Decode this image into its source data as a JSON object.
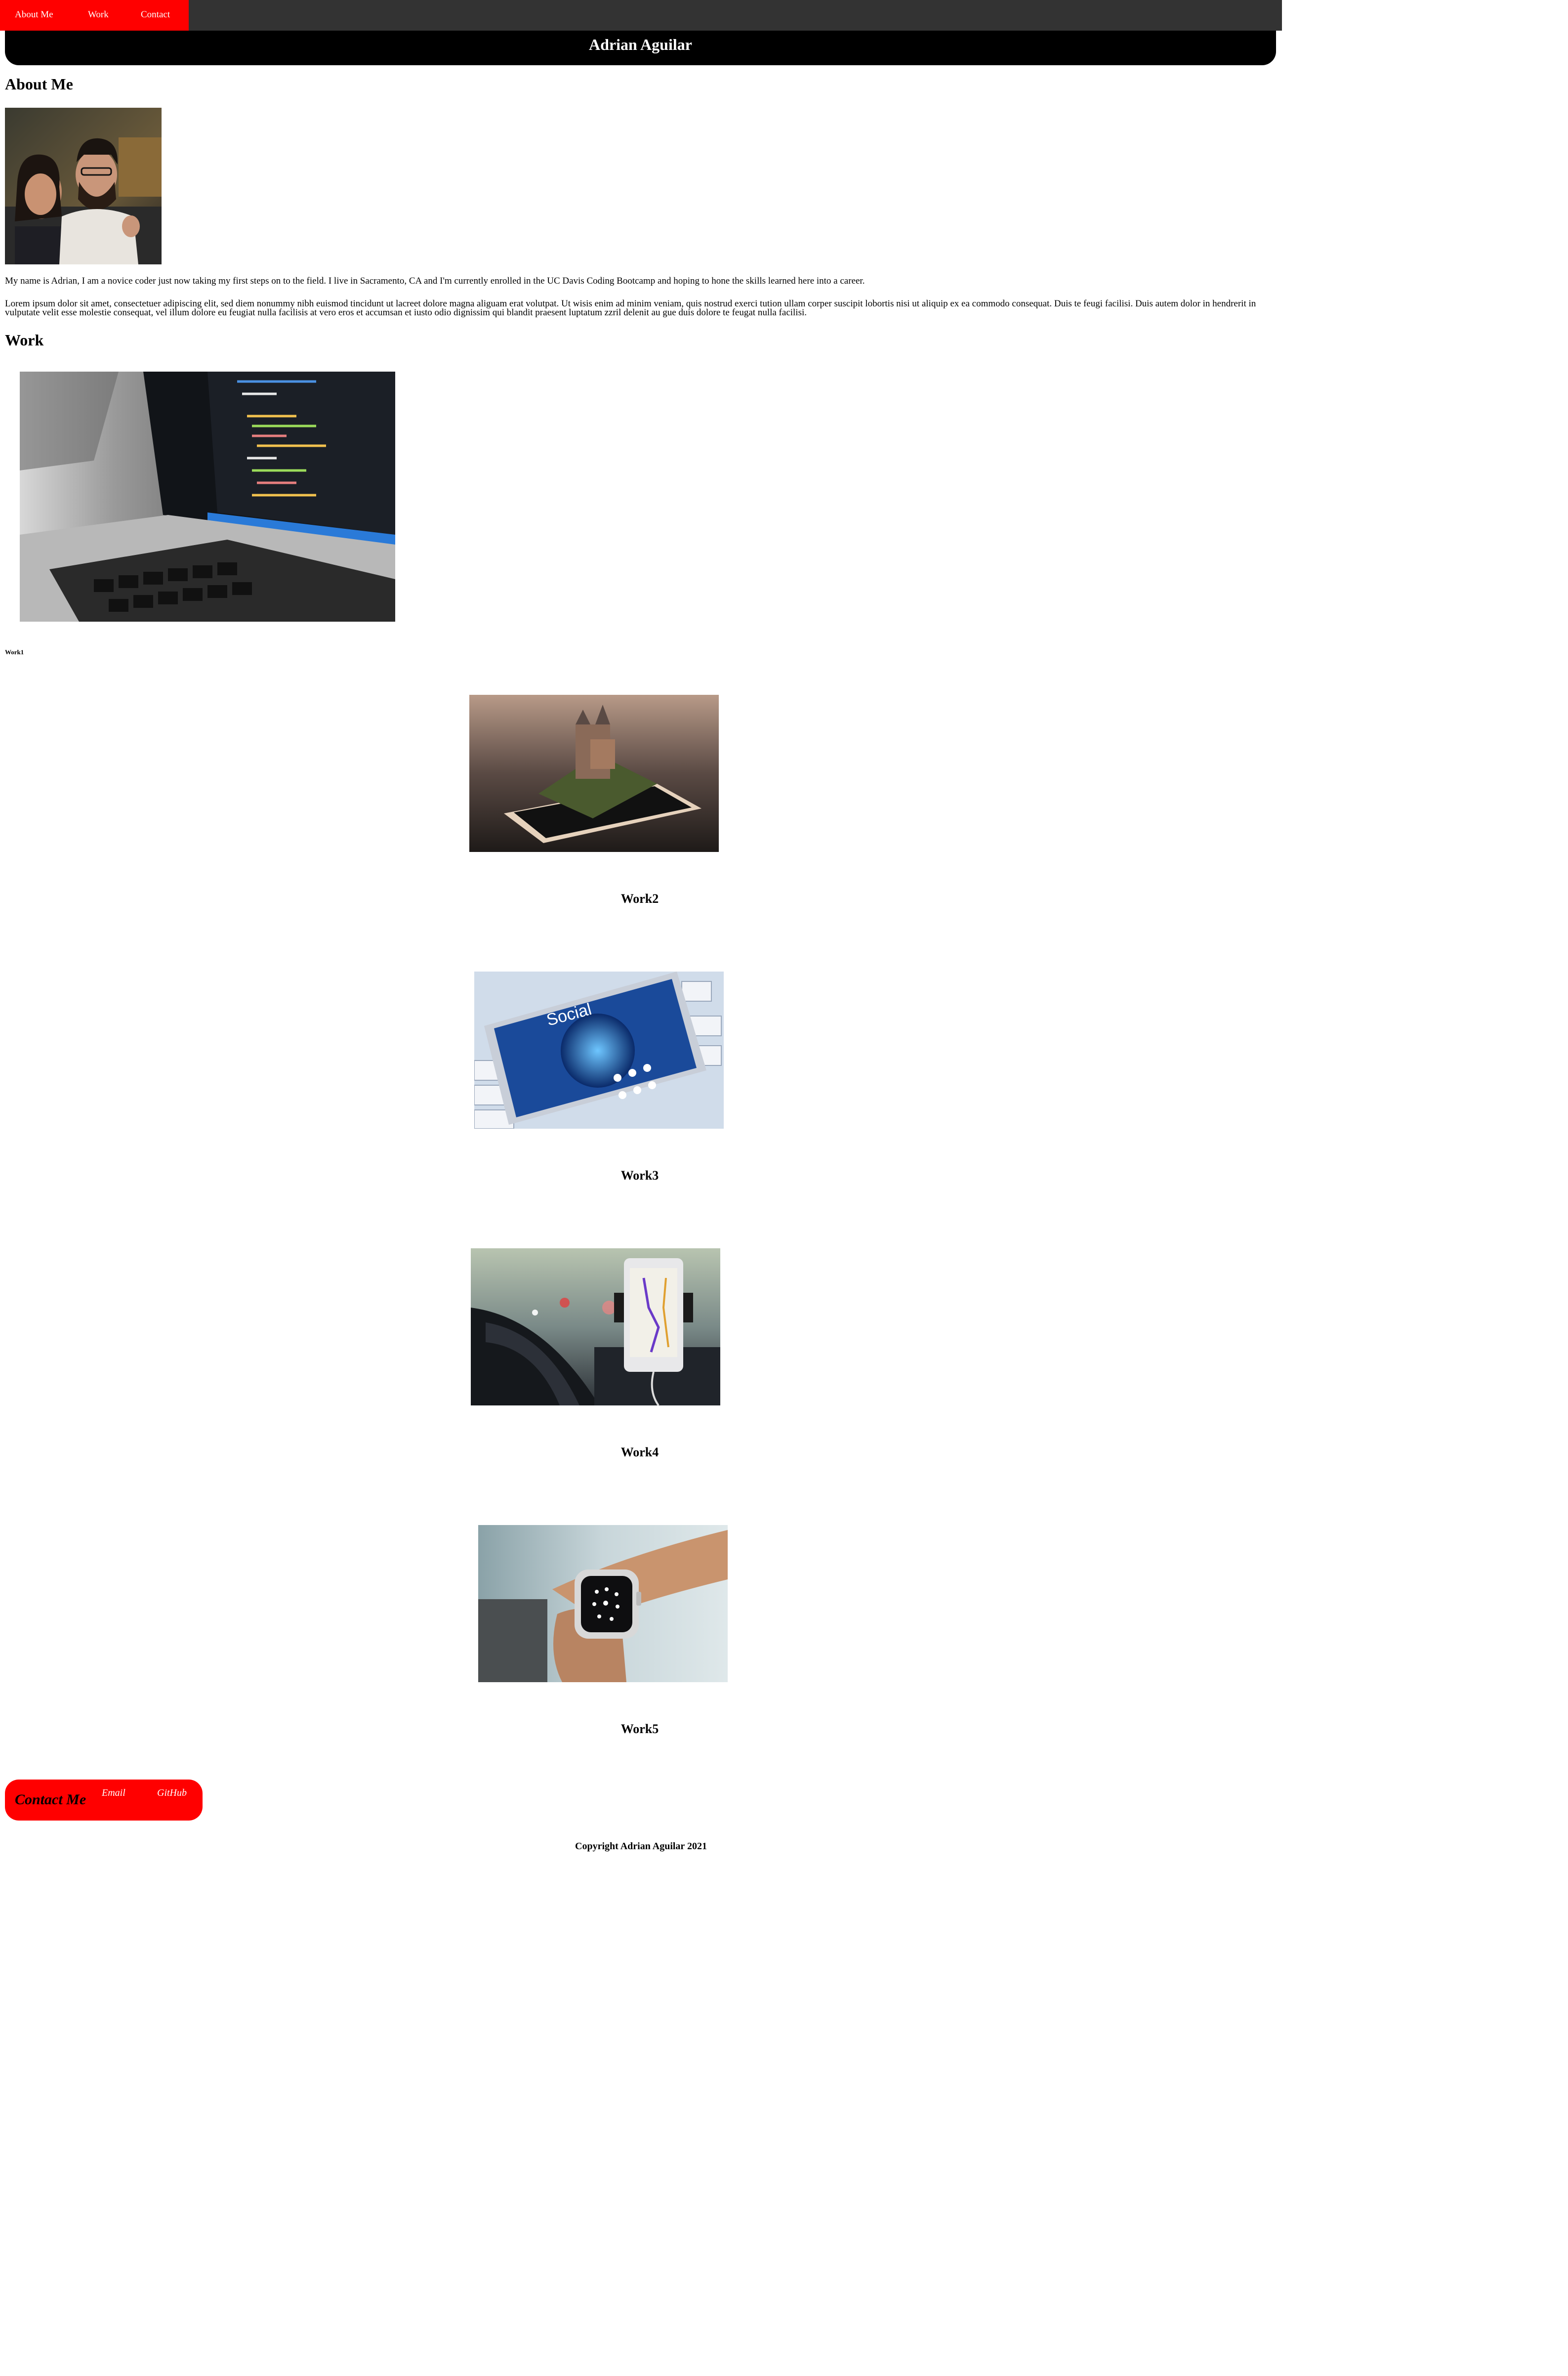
{
  "nav": {
    "links": [
      "About Me",
      "Work",
      "Contact"
    ]
  },
  "header": {
    "title": "Adrian Aguilar"
  },
  "about": {
    "heading": "About Me",
    "paragraph1": "My name is Adrian, I am a novice coder just now taking my first steps on to the field. I live in Sacramento, CA and I'm currently enrolled in the UC Davis Coding Bootcamp and hoping to hone the skills learned here into a career.",
    "paragraph2": "Lorem ipsum dolor sit amet, consectetuer adipiscing elit, sed diem nonummy nibh euismod tincidunt ut lacreet dolore magna aliguam erat volutpat. Ut wisis enim ad minim veniam, quis nostrud exerci tution ullam corper suscipit lobortis nisi ut aliquip ex ea commodo consequat. Duis te feugi facilisi. Duis autem dolor in hendrerit in vulputate velit esse molestie consequat, vel illum dolore eu feugiat nulla facilisis at vero eros et accumsan et iusto odio dignissim qui blandit praesent luptatum zzril delenit au gue duis dolore te feugat nulla facilisi.",
    "photo_icon": "profile-photo"
  },
  "work": {
    "heading": "Work",
    "items": [
      {
        "caption": "Work1",
        "image_icon": "laptop-code-photo"
      },
      {
        "caption": "Work2",
        "image_icon": "phone-castle-photo"
      },
      {
        "caption": "Work3",
        "image_icon": "phone-social-photo"
      },
      {
        "caption": "Work4",
        "image_icon": "car-gps-photo"
      },
      {
        "caption": "Work5",
        "image_icon": "smartwatch-photo"
      }
    ]
  },
  "contact": {
    "title": "Contact Me",
    "links": [
      "Email",
      "GitHub"
    ]
  },
  "footer": {
    "copyright": "Copyright Adrian Aguilar 2021"
  },
  "colors": {
    "nav_bg": "#333333",
    "accent": "#ff0000",
    "header_bg": "#000000"
  }
}
